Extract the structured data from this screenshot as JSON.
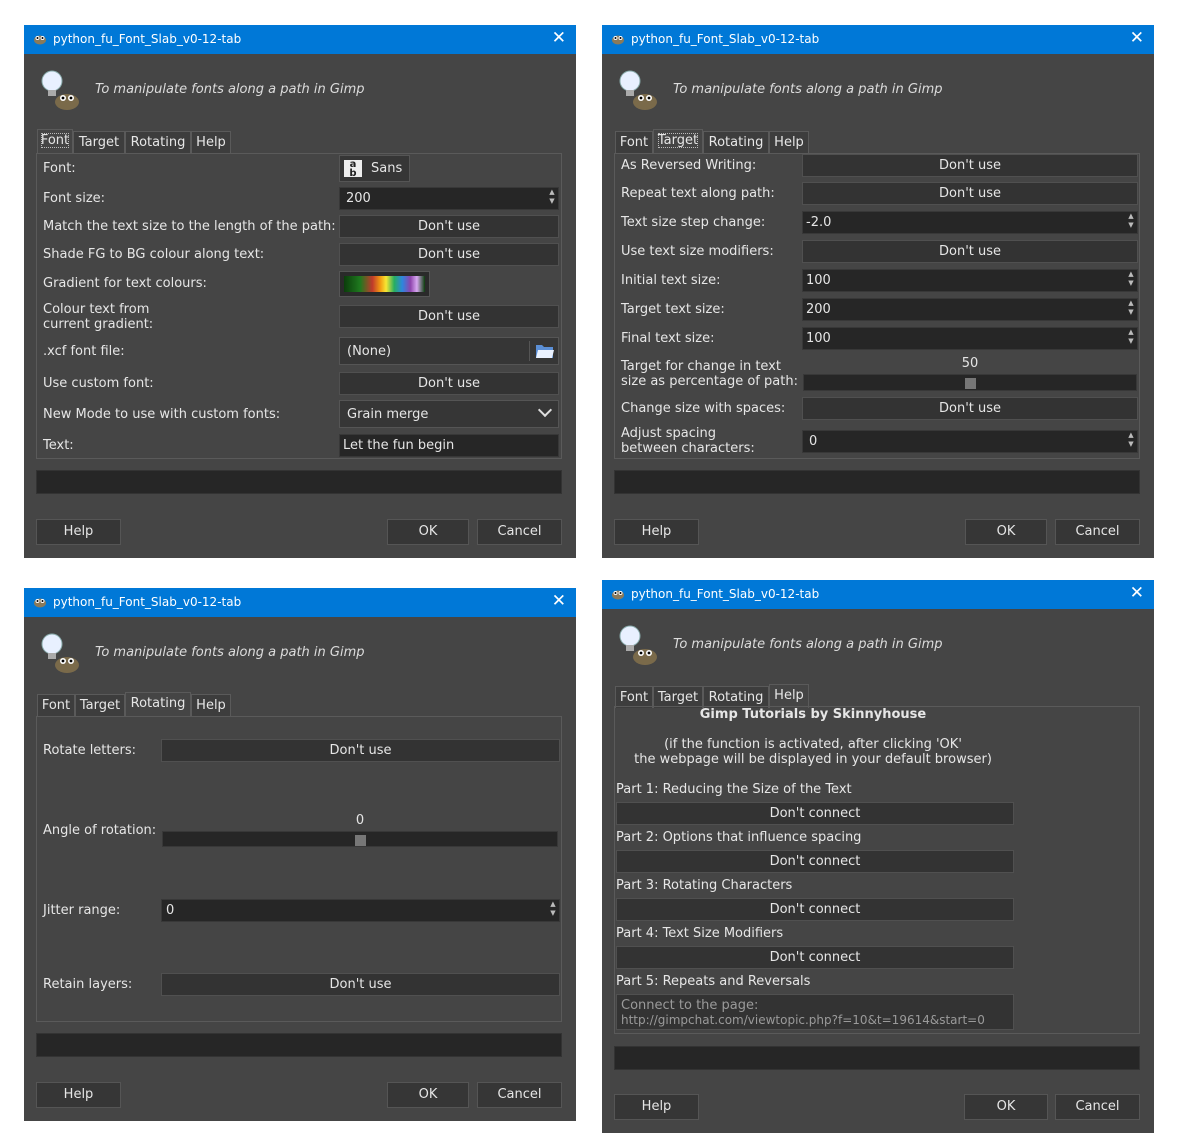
{
  "window": {
    "title": "python_fu_Font_Slab_v0-12-tab",
    "subtitle": "To manipulate fonts along a path in Gimp",
    "tabs": [
      "Font",
      "Target",
      "Rotating",
      "Help"
    ],
    "help_label": "Help",
    "ok_label": "OK",
    "cancel_label": "Cancel",
    "close_glyph": "✕"
  },
  "font_tab": {
    "font_label": "Font:",
    "font_value": "Sans",
    "font_size_label": "Font size:",
    "font_size_value": "200",
    "match_label": "Match the text size to the length of the path:",
    "match_value": "Don't use",
    "shade_label": "Shade FG to BG colour along text:",
    "shade_value": "Don't use",
    "gradient_label": "Gradient for text colours:",
    "colour_text_label_1": "Colour text from",
    "colour_text_label_2": "current gradient:",
    "colour_text_value": "Don't use",
    "xcf_label": ".xcf font file:",
    "xcf_value": "(None)",
    "custom_font_label": "Use custom font:",
    "custom_font_value": "Don't use",
    "mode_label": "New Mode to use with custom fonts:",
    "mode_value": "Grain merge",
    "text_label": "Text:",
    "text_value": "Let the fun begin"
  },
  "target_tab": {
    "reversed_label": "As Reversed Writing:",
    "reversed_value": "Don't use",
    "repeat_label": "Repeat text along path:",
    "repeat_value": "Don't use",
    "step_label": "Text size step change:",
    "step_value": "-2.0",
    "modifiers_label": "Use text size modifiers:",
    "modifiers_value": "Don't use",
    "initial_label": "Initial text size:",
    "initial_value": "100",
    "target_label": "Target text size:",
    "target_value": "200",
    "final_label": "Final text size:",
    "final_value": "100",
    "pct_label_1": "Target for change in text",
    "pct_label_2": "size as percentage of path:",
    "pct_value": "50",
    "pct_level": 0.5,
    "spaces_label": "Change size with spaces:",
    "spaces_value": "Don't use",
    "spacing_label_1": "Adjust spacing",
    "spacing_label_2": "between characters:",
    "spacing_value": "0"
  },
  "rotating_tab": {
    "rotate_label": "Rotate letters:",
    "rotate_value": "Don't use",
    "angle_label": "Angle of rotation:",
    "angle_value": "0",
    "angle_level": 0.5,
    "jitter_label": "Jitter range:",
    "jitter_value": "0",
    "retain_label": "Retain layers:",
    "retain_value": "Don't use"
  },
  "help_tab": {
    "heading": "Gimp Tutorials by Skinnyhouse",
    "note_1": "(if the function is activated, after clicking 'OK'",
    "note_2": "the webpage will be displayed in your default browser)",
    "part1": "Part 1: Reducing the Size of the Text",
    "part2": "Part 2: Options that influence spacing",
    "part3": "Part 3: Rotating Characters",
    "part4": "Part 4: Text Size Modifiers",
    "part5": "Part 5: Repeats and Reversals",
    "connect_value": "Don't connect",
    "link_line_1": "Connect to the page:",
    "link_line_2": "http://gimpchat.com/viewtopic.php?f=10&t=19614&start=0"
  },
  "icons": [
    "gimp-wilber-icon",
    "lightbulb-icon",
    "close-icon",
    "folder-open-icon",
    "font-icon",
    "chevron-down-icon"
  ],
  "colors": {
    "titlebar": "#0078d7",
    "dialog_bg": "#454545",
    "field_bg": "#262626"
  }
}
